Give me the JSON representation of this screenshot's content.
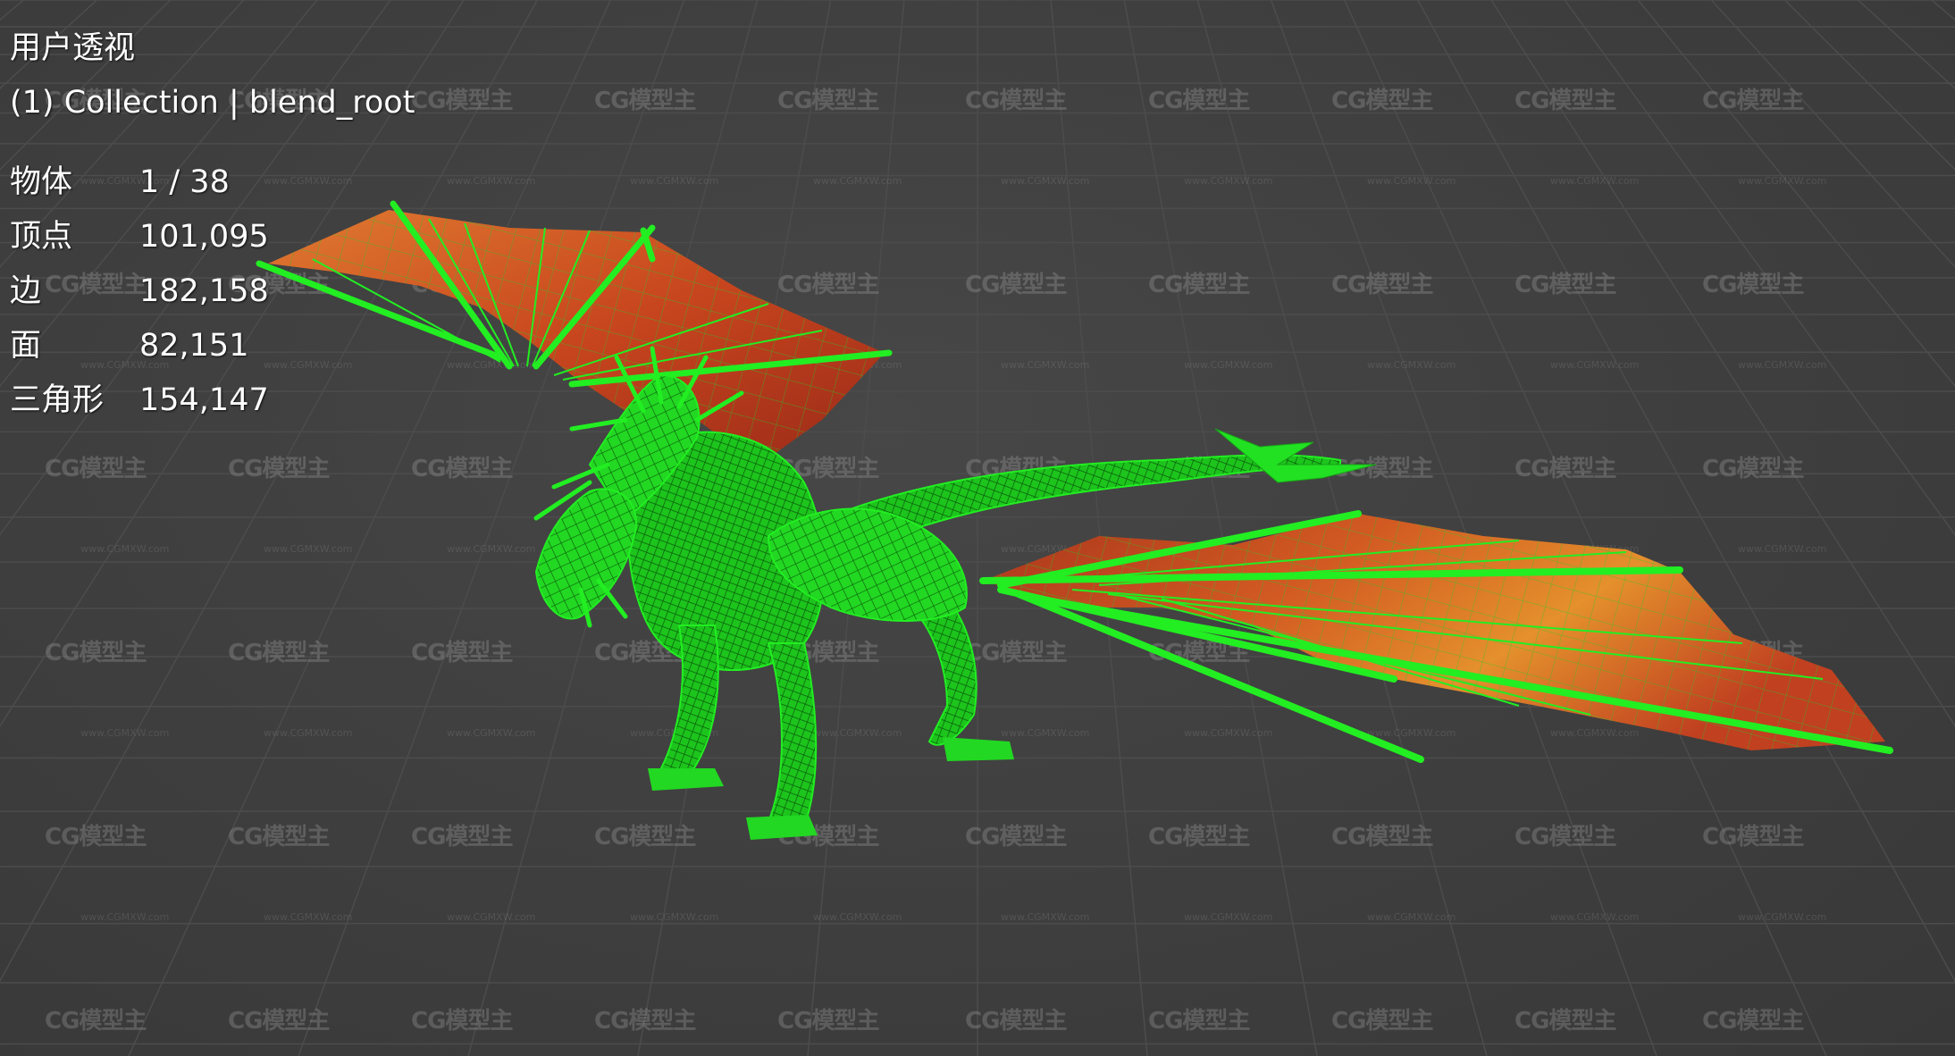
{
  "viewport": {
    "view_name": "用户透视",
    "collection_label": "(1) Collection | blend_root"
  },
  "statistics": [
    {
      "label": "物体",
      "value": "1 / 38"
    },
    {
      "label": "顶点",
      "value": "101,095"
    },
    {
      "label": "边",
      "value": "182,158"
    },
    {
      "label": "面",
      "value": "82,151"
    },
    {
      "label": "三角形",
      "value": "154,147"
    }
  ],
  "watermark": {
    "logo_text": "CG模型主",
    "url_text": "www.CGMXW.com"
  },
  "colors": {
    "background": "#3d3d3d",
    "grid_line": "#4a4a4a",
    "wireframe": "#22ee22",
    "wing_membrane": "#c8461e",
    "wing_highlight": "#e08a2a"
  },
  "icons": {
    "model": "dragon-wireframe-model"
  }
}
